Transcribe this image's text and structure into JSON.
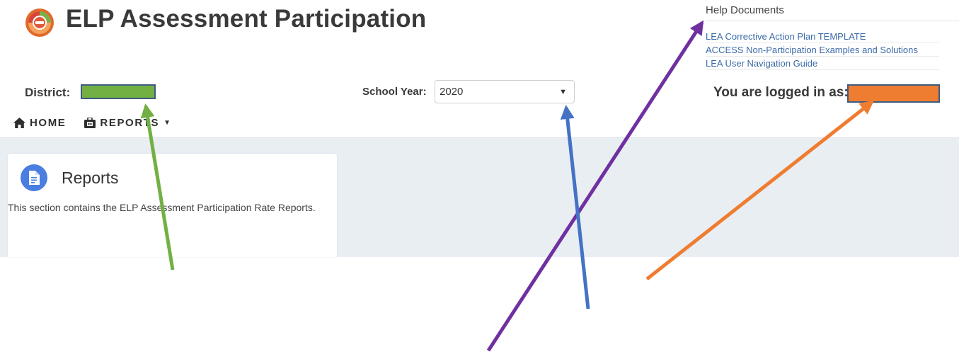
{
  "header": {
    "app_title": "ELP Assessment Participation"
  },
  "help": {
    "heading": "Help Documents",
    "links": [
      "LEA Corrective Action Plan TEMPLATE",
      "ACCESS Non-Participation Examples and Solutions",
      "LEA User Navigation Guide"
    ]
  },
  "filters": {
    "district_label": "District:",
    "school_year_label": "School Year:",
    "school_year_value": "2020"
  },
  "user": {
    "logged_in_label": "You are logged in as:"
  },
  "nav": {
    "home_label": "HOME",
    "reports_label": "REPORTS"
  },
  "reports_card": {
    "title": "Reports",
    "description": "This section contains the ELP Assessment Participation Rate Reports."
  },
  "colors": {
    "district_redaction": "#72b043",
    "user_redaction": "#ef7d31",
    "arrow_green": "#72b043",
    "arrow_purple": "#7030a0",
    "arrow_blue": "#4472c4",
    "arrow_orange": "#ef7d31",
    "link": "#3b6aa8",
    "card_icon": "#4a7ee0"
  }
}
